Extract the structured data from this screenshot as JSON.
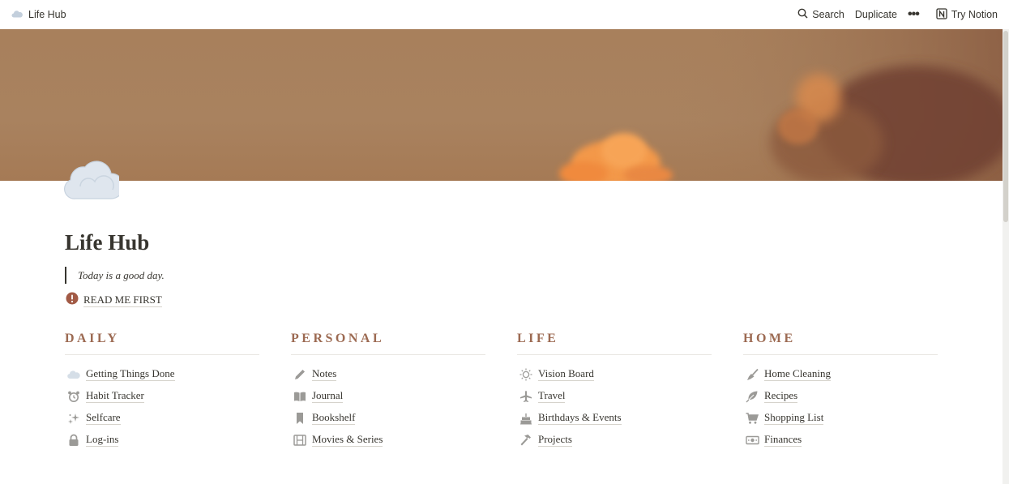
{
  "topbar": {
    "breadcrumb": "Life Hub",
    "breadcrumb_icon": "cloud-icon",
    "search_label": "Search",
    "duplicate_label": "Duplicate",
    "more_label": "•••",
    "try_notion_label": "Try Notion"
  },
  "page": {
    "icon": "cloud-icon",
    "title": "Life Hub",
    "quote": "Today is a good day.",
    "readme_icon": "exclamation-icon",
    "readme_label": "READ ME FIRST"
  },
  "columns": [
    {
      "heading": "DAILY",
      "items": [
        {
          "label": "Getting Things Done",
          "icon": "cloud-icon"
        },
        {
          "label": "Habit Tracker",
          "icon": "alarm-clock-icon"
        },
        {
          "label": "Selfcare",
          "icon": "sparkles-icon"
        },
        {
          "label": "Log-ins",
          "icon": "lock-icon"
        }
      ]
    },
    {
      "heading": "PERSONAL",
      "items": [
        {
          "label": "Notes",
          "icon": "pencil-icon"
        },
        {
          "label": "Journal",
          "icon": "book-icon"
        },
        {
          "label": "Bookshelf",
          "icon": "bookmark-icon"
        },
        {
          "label": "Movies & Series",
          "icon": "film-icon"
        }
      ]
    },
    {
      "heading": "LIFE",
      "items": [
        {
          "label": "Vision Board",
          "icon": "sun-icon"
        },
        {
          "label": "Travel",
          "icon": "airplane-icon"
        },
        {
          "label": "Birthdays & Events",
          "icon": "cake-icon"
        },
        {
          "label": "Projects",
          "icon": "hammer-icon"
        }
      ]
    },
    {
      "heading": "HOME",
      "items": [
        {
          "label": "Home Cleaning",
          "icon": "broom-icon"
        },
        {
          "label": "Recipes",
          "icon": "leaf-icon"
        },
        {
          "label": "Shopping List",
          "icon": "cart-icon"
        },
        {
          "label": "Finances",
          "icon": "money-icon"
        }
      ]
    }
  ],
  "colors": {
    "heading_accent": "#9c6a52",
    "text": "#37352f",
    "icon_gray": "#9b9a97",
    "cover_base": "#a8805c"
  }
}
